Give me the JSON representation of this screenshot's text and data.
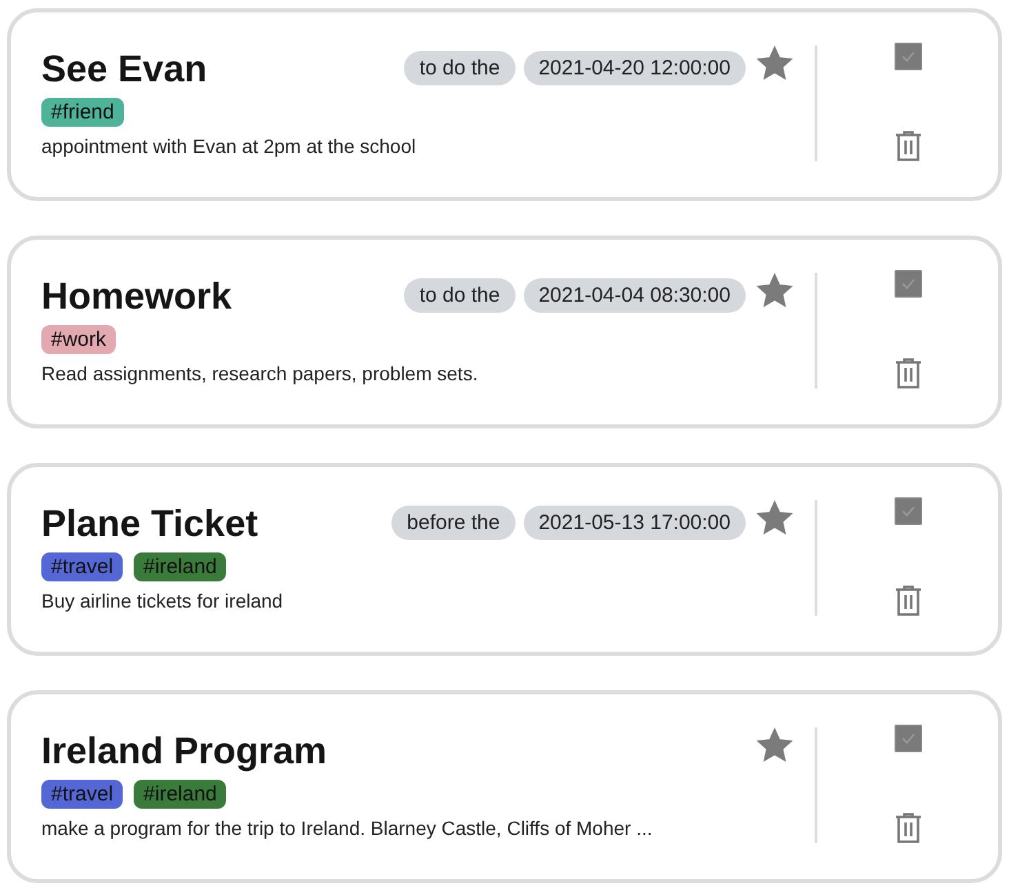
{
  "tasks": [
    {
      "title": "See Evan",
      "when": "to do the",
      "date": "2021-04-20 12:00:00",
      "starred": true,
      "done": true,
      "tags": [
        {
          "label": "#friend",
          "color": "#4fb39a"
        }
      ],
      "description": "appointment with Evan at 2pm at the school"
    },
    {
      "title": "Homework",
      "when": "to do the",
      "date": "2021-04-04 08:30:00",
      "starred": true,
      "done": true,
      "tags": [
        {
          "label": "#work",
          "color": "#e2a9b0"
        }
      ],
      "description": "Read assignments, research papers, problem sets."
    },
    {
      "title": "Plane Ticket",
      "when": "before the",
      "date": "2021-05-13 17:00:00",
      "starred": true,
      "done": true,
      "tags": [
        {
          "label": "#travel",
          "color": "#5467d4"
        },
        {
          "label": "#ireland",
          "color": "#3a7a3a"
        }
      ],
      "description": "Buy airline tickets for ireland"
    },
    {
      "title": "Ireland Program",
      "starred": true,
      "done": true,
      "tags": [
        {
          "label": "#travel",
          "color": "#5467d4"
        },
        {
          "label": "#ireland",
          "color": "#3a7a3a"
        }
      ],
      "description": "make a program for the trip to Ireland. Blarney Castle, Cliffs of Moher ..."
    }
  ]
}
